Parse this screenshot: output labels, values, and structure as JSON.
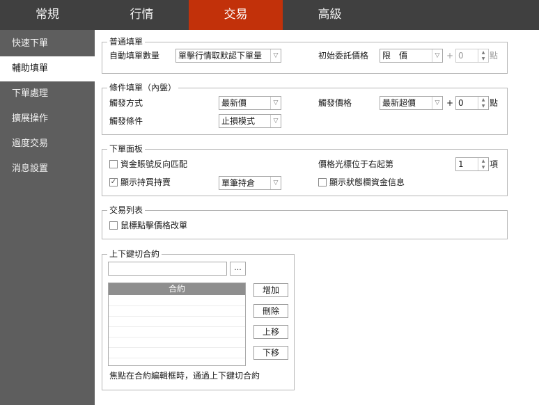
{
  "tabs": [
    "常規",
    "行情",
    "交易",
    "高級"
  ],
  "sidebar": {
    "items": [
      "快速下單",
      "輔助填單",
      "下單處理",
      "擴展操作",
      "過度交易",
      "消息設置"
    ]
  },
  "normal_fill": {
    "title": "普通填單",
    "auto_qty_label": "自動填單數量",
    "auto_qty_value": "單擊行情取默認下單量",
    "init_price_label": "初始委託價格",
    "init_price_value": "限　價",
    "plus": "+",
    "offset": "0",
    "unit": "點"
  },
  "cond_fill": {
    "title": "條件填單（內盤）",
    "trigger_method_label": "觸發方式",
    "trigger_method_value": "最新價",
    "trigger_price_label": "觸發價格",
    "trigger_price_value": "最新超價",
    "plus": "+",
    "offset": "0",
    "unit": "點",
    "trigger_cond_label": "觸發條件",
    "trigger_cond_value": "止損模式"
  },
  "order_panel": {
    "title": "下單面板",
    "reverse_match_label": "資金賬號反向匹配",
    "cursor_label": "價格光標位于右起第",
    "cursor_value": "1",
    "cursor_unit": "項",
    "show_position_label": "顯示持買持賣",
    "position_mode_value": "單筆持倉",
    "show_status_label": "顯示狀態欄資金信息",
    "check_mark": "✓"
  },
  "trade_list": {
    "title": "交易列表",
    "mouse_modify_label": "鼠標點擊價格改單"
  },
  "contract_switch": {
    "title": "上下鍵切合約",
    "browse": "...",
    "column": "合約",
    "add": "增加",
    "delete": "刪除",
    "up": "上移",
    "down": "下移",
    "note": "焦點在合約編輯框時，通過上下鍵切合約"
  }
}
